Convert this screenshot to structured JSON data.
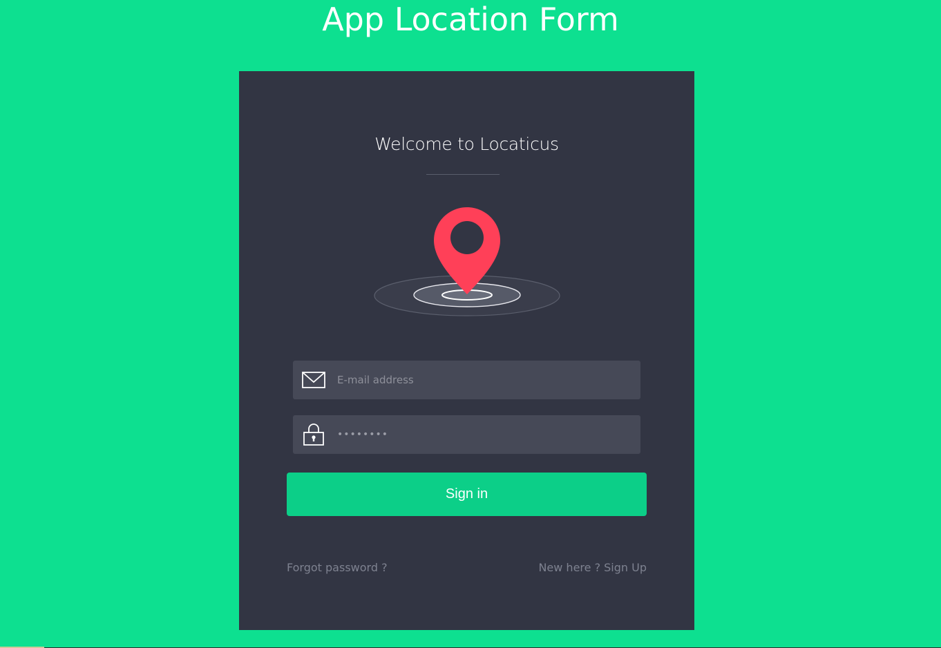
{
  "page": {
    "title": "App Location Form"
  },
  "card": {
    "welcome": "Welcome to Locaticus",
    "illustration_icon": "map-pin-icon"
  },
  "form": {
    "email": {
      "icon": "envelope-icon",
      "placeholder": "E-mail address",
      "value": ""
    },
    "password": {
      "icon": "padlock-icon",
      "placeholder": "",
      "value": "••••••••"
    },
    "signin_label": "Sign in"
  },
  "links": {
    "forgot": "Forgot password ?",
    "signup": "New here ? Sign Up"
  },
  "colors": {
    "background": "#0de090",
    "card": "#323543",
    "field": "#464957",
    "button": "#0ccf88",
    "pin": "#ff4058"
  }
}
